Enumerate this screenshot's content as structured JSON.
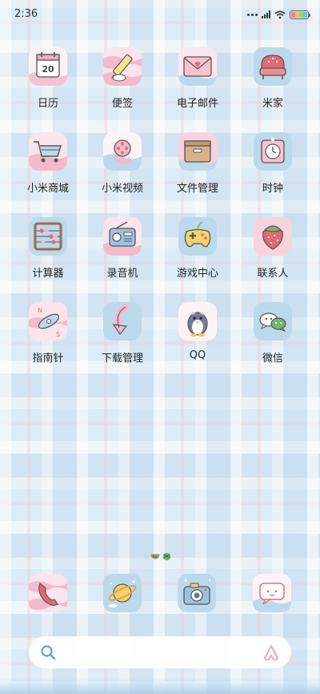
{
  "status_bar": {
    "time": "2:36"
  },
  "apps": [
    {
      "id": "calendar",
      "label": "日历",
      "date": "20"
    },
    {
      "id": "notes",
      "label": "便签"
    },
    {
      "id": "email",
      "label": "电子邮件"
    },
    {
      "id": "mi-home",
      "label": "米家"
    },
    {
      "id": "mi-store",
      "label": "小米商城"
    },
    {
      "id": "mi-video",
      "label": "小米视频"
    },
    {
      "id": "file-manager",
      "label": "文件管理"
    },
    {
      "id": "clock",
      "label": "时钟"
    },
    {
      "id": "calculator",
      "label": "计算器"
    },
    {
      "id": "recorder",
      "label": "录音机"
    },
    {
      "id": "game-center",
      "label": "游戏中心"
    },
    {
      "id": "contacts",
      "label": "联系人"
    },
    {
      "id": "compass",
      "label": "指南针"
    },
    {
      "id": "downloads",
      "label": "下载管理"
    },
    {
      "id": "qq",
      "label": "QQ"
    },
    {
      "id": "wechat",
      "label": "微信"
    }
  ],
  "dock": [
    "phone",
    "browser",
    "camera",
    "messages"
  ],
  "compass_letters": {
    "n": "N",
    "s": "S"
  },
  "colors": {
    "pink": "#f4b9cc",
    "blue": "#bcd9ec",
    "red": "#e36a72",
    "green": "#76b56a"
  }
}
